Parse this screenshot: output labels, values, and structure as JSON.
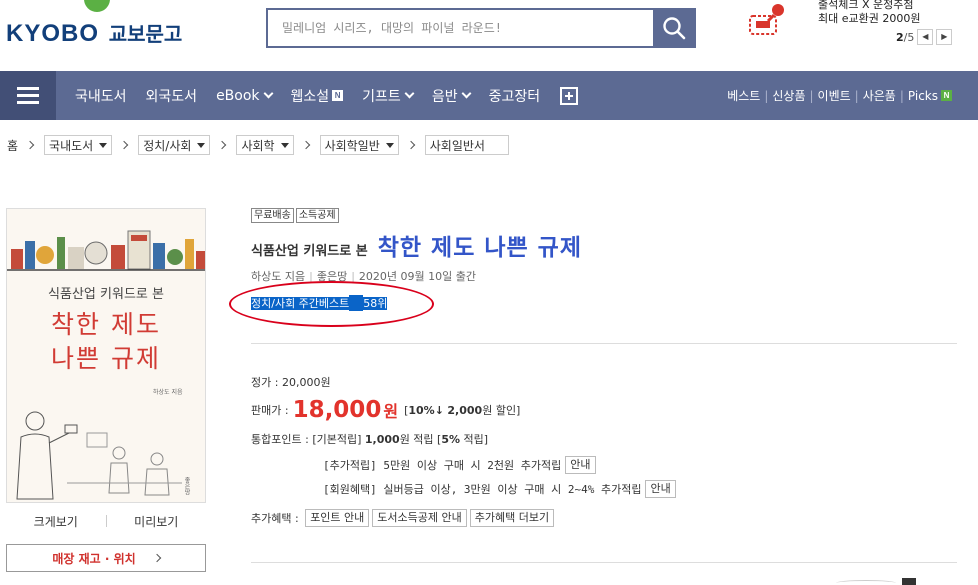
{
  "header": {
    "logo_latin": "KYOBO",
    "logo_korean": "교보문고",
    "search_placeholder": "밀레니엄 시리즈, 대망의 파이널 라운드!",
    "promo_line1": "출석체크 X 운정추첨",
    "promo_line2": "최대 e교환권 2000원",
    "pager_current": "2",
    "pager_total": "/5",
    "pager_prev": "◀",
    "pager_next": "▶"
  },
  "nav": {
    "items": [
      {
        "label": "국내도서"
      },
      {
        "label": "외국도서"
      },
      {
        "label": "eBook"
      },
      {
        "label": "웹소설",
        "badge": "N"
      },
      {
        "label": "기프트"
      },
      {
        "label": "음반"
      },
      {
        "label": "중고장터"
      }
    ],
    "right": [
      "베스트",
      "신상품",
      "이벤트",
      "사은품",
      "Picks"
    ],
    "picks_badge": "N"
  },
  "breadcrumb": {
    "home": "홈",
    "levels": [
      "국내도서",
      "정치/사회",
      "사회학",
      "사회학일반",
      "사회일반서"
    ]
  },
  "book": {
    "tags": [
      "무료배송",
      "소득공제"
    ],
    "subtitle": "식품산업 키워드로 본",
    "title": "착한 제도 나쁜 규제",
    "author": "하상도 지음",
    "publisher": "좋은땅",
    "pub_date": "2020년 09월 10일 출간",
    "best_text": "정치/사회 주간베스트",
    "best_rank": "58위",
    "cover": {
      "subtitle": "식품산업 키워드로 본",
      "title_line1": "착한 제도",
      "title_line2": "나쁜 규제",
      "author": "하상도 지음",
      "publisher": "좋은땅"
    },
    "cover_links": [
      "크게보기",
      "미리보기"
    ],
    "stock_button": "매장 재고 · 위치"
  },
  "price": {
    "list_label": "정가 :",
    "list_price": "20,000원",
    "sale_label": "판매가 :",
    "sale_price": "18,000",
    "sale_unit": "원",
    "discount_open": "[",
    "discount_pct": "10%↓",
    "discount_amount": "2,000",
    "discount_tail": "원 할인]",
    "points_label": "통합포인트 :",
    "points_base_a": "[기본적립]",
    "points_base_b": "1,000",
    "points_base_c": "원 적립",
    "points_rate_a": "[",
    "points_rate_b": "5%",
    "points_rate_c": "적립]",
    "extra_points": "[추가적립] 5만원 이상 구매 시 2천원 추가적립",
    "member_points": "[회원혜택] 실버등급 이상, 3만원 이상 구매 시 2~4% 추가적립",
    "guide": "안내",
    "benefits_label": "추가혜택 :",
    "benefit_buttons": [
      "포인트 안내",
      "도서소득공제 안내",
      "추가혜택 더보기"
    ]
  }
}
